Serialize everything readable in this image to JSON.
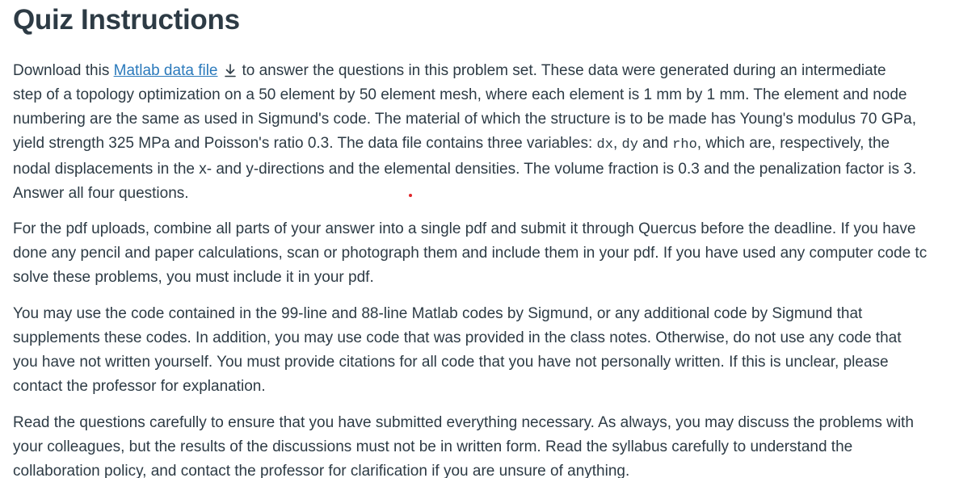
{
  "title": "Quiz Instructions",
  "p1": {
    "l1_pre": "Download this ",
    "link": "Matlab data file",
    "l1_post": "to answer the questions in this problem set. These data were generated during an intermediate",
    "l2": "step of a topology optimization on a 50 element by 50 element mesh, where each element is 1 mm by 1 mm. The element and node",
    "l3": "numbering are the same as used in Sigmund's code. The material of which the structure is to be made has Young's modulus 70 GPa,",
    "l4_a": "yield strength 325 MPa and Poisson's ratio 0.3. The data file contains three variables: ",
    "var1": "dx",
    "l4_b": ", ",
    "var2": "dy",
    "l4_c": " and ",
    "var3": "rho",
    "l4_d": ", which are, respectively, the",
    "l5": "nodal displacements in the x- and y-directions and the elemental densities. The volume fraction is 0.3 and the penalization factor is 3.",
    "l6": "Answer all four questions."
  },
  "p2": {
    "l1": "For the pdf uploads, combine all parts of your answer into a single pdf and submit it through Quercus before the deadline. If you have",
    "l2": "done any pencil and paper calculations, scan or photograph them and include them in your pdf. If you have used any computer code tc",
    "l3": "solve these problems, you must include it in your pdf."
  },
  "p3": {
    "l1": "You may use the code contained in the 99-line and 88-line Matlab codes by Sigmund, or any additional code by Sigmund that",
    "l2": "supplements these codes. In addition, you may use code that was provided in the class notes. Otherwise, do not use any code that",
    "l3": "you have not written yourself. You must provide citations for all code that you have not personally written. If this is unclear, please",
    "l4": "contact the professor for explanation."
  },
  "p4": {
    "l1": "Read the questions carefully to ensure that you have submitted everything necessary. As always, you may discuss the problems with",
    "l2": "your colleagues, but the results of the discussions must not be in written form. Read the syllabus carefully to understand the",
    "l3": "collaboration policy, and contact the professor for clarification if you are unsure of anything."
  },
  "icons": {
    "download": "download-icon"
  },
  "colors": {
    "text": "#2d3b45",
    "link": "#2b7abc",
    "marker": "#e0262b"
  }
}
